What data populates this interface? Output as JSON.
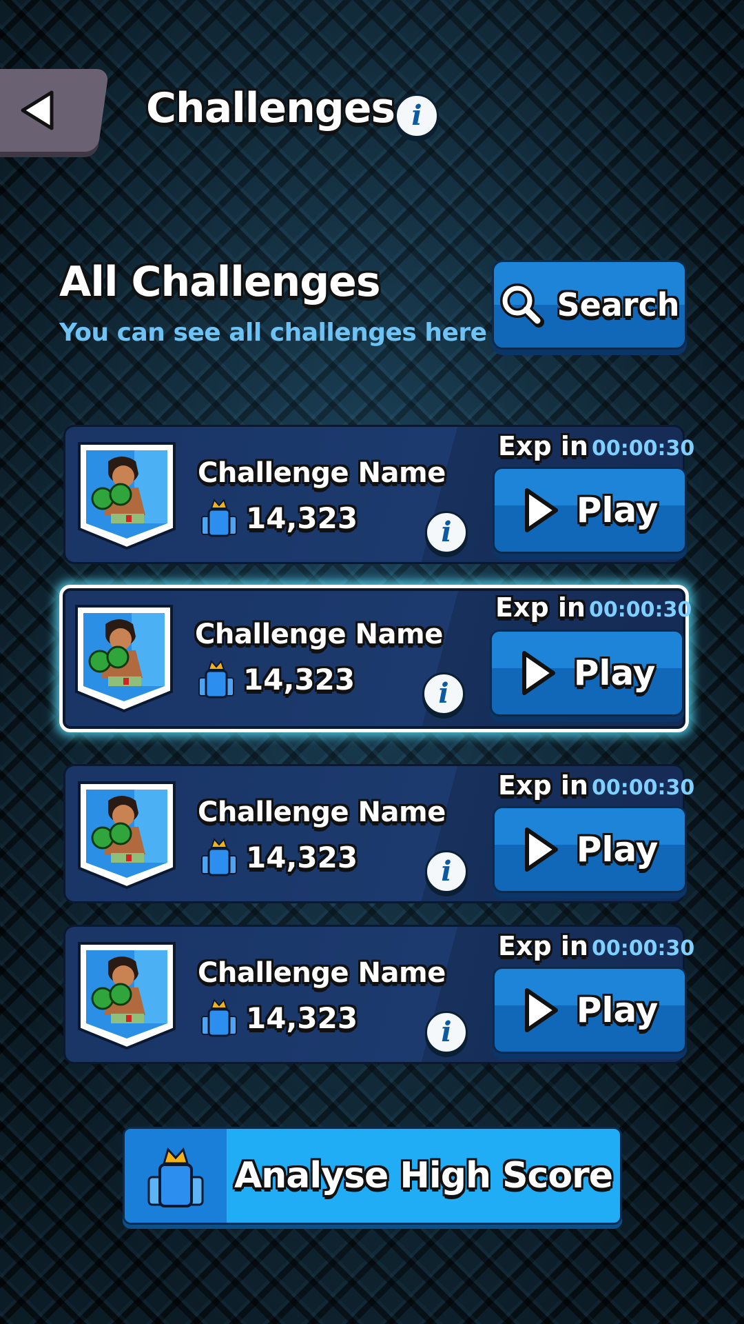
{
  "header": {
    "title": "Challenges"
  },
  "section": {
    "title": "All Challenges",
    "subtitle": "You can see all challenges here",
    "search_label": "Search"
  },
  "challenges": [
    {
      "name": "Challenge Name",
      "score": "14,323",
      "exp_label": "Exp in",
      "exp_time": "00:00:30",
      "play_label": "Play",
      "selected": false
    },
    {
      "name": "Challenge Name",
      "score": "14,323",
      "exp_label": "Exp in",
      "exp_time": "00:00:30",
      "play_label": "Play",
      "selected": true
    },
    {
      "name": "Challenge Name",
      "score": "14,323",
      "exp_label": "Exp in",
      "exp_time": "00:00:30",
      "play_label": "Play",
      "selected": false
    },
    {
      "name": "Challenge Name",
      "score": "14,323",
      "exp_label": "Exp in",
      "exp_time": "00:00:30",
      "play_label": "Play",
      "selected": false
    }
  ],
  "footer": {
    "analyse_label": "Analyse High Score"
  },
  "icons": {
    "back": "back-arrow-icon",
    "info": "info-icon",
    "search": "search-icon",
    "play": "play-icon",
    "score": "trophy-crown-icon",
    "thumbnail": "boxer-avatar-icon"
  },
  "colors": {
    "accent_blue": "#1e84d8",
    "subtitle_blue": "#6fc3f4",
    "timer_blue": "#7fd0ff",
    "analyse_blue": "#20adf5",
    "selected_glow": "#5ae6ff"
  }
}
